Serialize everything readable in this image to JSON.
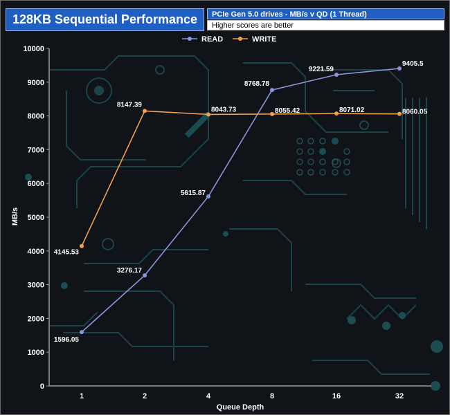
{
  "chart_data": {
    "type": "line",
    "title": "128KB Sequential Performance",
    "subtitle": "PCIe Gen 5.0 drives - MB/s v QD (1 Thread)",
    "note": "Higher scores are better",
    "xlabel": "Queue Depth",
    "ylabel": "MB/s",
    "categories": [
      "1",
      "2",
      "4",
      "8",
      "16",
      "32"
    ],
    "ylim": [
      0,
      10000
    ],
    "yticks": [
      "0",
      "1000",
      "2000",
      "3000",
      "4000",
      "5000",
      "6000",
      "7000",
      "8000",
      "9000",
      "10000"
    ],
    "legend_position": "top-center",
    "grid": false,
    "series": [
      {
        "name": "READ",
        "color": "#8a96dc",
        "values": [
          1596.05,
          3276.17,
          5615.87,
          8768.78,
          9221.59,
          9405.5
        ],
        "labels": [
          "1596.05",
          "3276.17",
          "5615.87",
          "8768.78",
          "9221.59",
          "9405.5"
        ]
      },
      {
        "name": "WRITE",
        "color": "#f0a050",
        "values": [
          4145.53,
          8147.39,
          8043.73,
          8055.42,
          8071.02,
          8060.05
        ],
        "labels": [
          "4145.53",
          "8147.39",
          "8043.73",
          "8055.42",
          "8071.02",
          "8060.05"
        ]
      }
    ]
  }
}
